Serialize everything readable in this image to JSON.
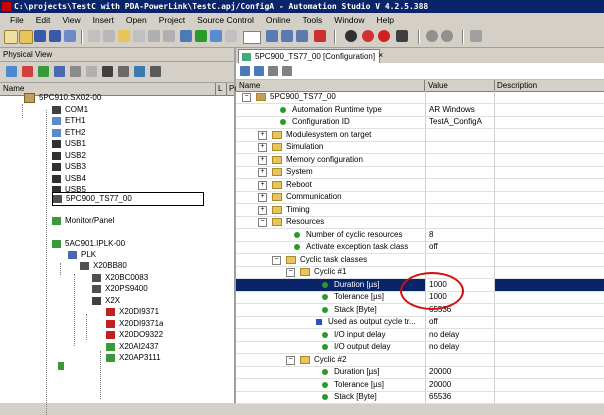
{
  "window": {
    "title": "C:\\projects\\TestC with PDA-PowerLink\\TestC.apj/ConfigA - Automation Studio V 4.2.5.388"
  },
  "menu": [
    "File",
    "Edit",
    "View",
    "Insert",
    "Open",
    "Project",
    "Source Control",
    "Online",
    "Tools",
    "Window",
    "Help"
  ],
  "physical_view": {
    "title": "Physical View",
    "columns": [
      "Name",
      "L",
      "Po"
    ],
    "items": [
      {
        "label": "5PC910.SX02-00"
      },
      {
        "label": "COM1"
      },
      {
        "label": "ETH1"
      },
      {
        "label": "ETH2"
      },
      {
        "label": "USB1"
      },
      {
        "label": "USB2"
      },
      {
        "label": "USB3"
      },
      {
        "label": "USB4"
      },
      {
        "label": "USB5"
      },
      {
        "label": "5PC900_TS77_00"
      },
      {
        "label": "Monitor/Panel"
      },
      {
        "label": "5AC901.IPLK-00"
      },
      {
        "label": "PLK"
      },
      {
        "label": "X20BB80"
      },
      {
        "label": "X20BC0083"
      },
      {
        "label": "X20PS9400"
      },
      {
        "label": "X2X"
      },
      {
        "label": "X20DI9371"
      },
      {
        "label": "X20DI9371a"
      },
      {
        "label": "X20DO9322"
      },
      {
        "label": "X20AI2437"
      },
      {
        "label": "X20AP3111"
      }
    ]
  },
  "editor": {
    "tab_label": "5PC900_TS77_00 [Configuration]",
    "close_glyph": "×",
    "columns": [
      "Name",
      "Value",
      "Description"
    ],
    "rows": [
      {
        "name": "5PC900_TS77_00",
        "value": ""
      },
      {
        "name": "Automation Runtime type",
        "value": "AR Windows"
      },
      {
        "name": "Configuration ID",
        "value": "TestA_ConfigA"
      },
      {
        "name": "Modulesystem on target",
        "value": ""
      },
      {
        "name": "Simulation",
        "value": ""
      },
      {
        "name": "Memory configuration",
        "value": ""
      },
      {
        "name": "System",
        "value": ""
      },
      {
        "name": "Reboot",
        "value": ""
      },
      {
        "name": "Communication",
        "value": ""
      },
      {
        "name": "Timing",
        "value": ""
      },
      {
        "name": "Resources",
        "value": ""
      },
      {
        "name": "Number of cyclic resources",
        "value": "8"
      },
      {
        "name": "Activate exception task class",
        "value": "off"
      },
      {
        "name": "Cyclic task classes",
        "value": ""
      },
      {
        "name": "Cyclic #1",
        "value": ""
      },
      {
        "name": "Duration [µs]",
        "value": "1000"
      },
      {
        "name": "Tolerance [µs]",
        "value": "1000"
      },
      {
        "name": "Stack [Byte]",
        "value": "65536"
      },
      {
        "name": "Used as output cycle tr...",
        "value": "off"
      },
      {
        "name": "I/O input delay",
        "value": "no delay"
      },
      {
        "name": "I/O output delay",
        "value": "no delay"
      },
      {
        "name": "Cyclic #2",
        "value": ""
      },
      {
        "name": "Duration [µs]",
        "value": "20000"
      },
      {
        "name": "Tolerance [µs]",
        "value": "20000"
      },
      {
        "name": "Stack [Byte]",
        "value": "65536"
      }
    ]
  },
  "colors": {
    "selection": "#0a246a",
    "highlight_circle": "#d01010"
  }
}
